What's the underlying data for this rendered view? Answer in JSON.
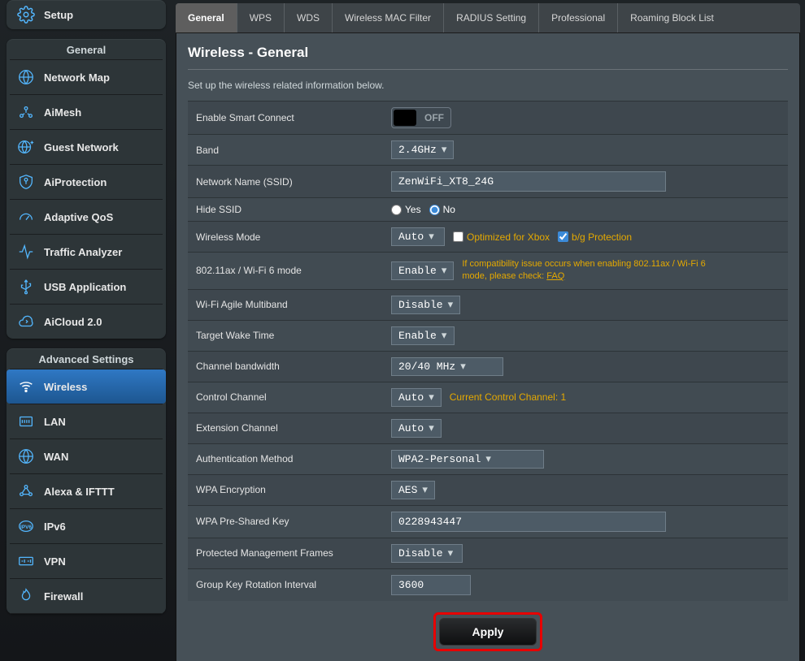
{
  "sidebar": {
    "top_item": "Setup",
    "general_header": "General",
    "general_items": [
      "Network Map",
      "AiMesh",
      "Guest Network",
      "AiProtection",
      "Adaptive QoS",
      "Traffic Analyzer",
      "USB Application",
      "AiCloud 2.0"
    ],
    "advanced_header": "Advanced Settings",
    "advanced_items": [
      "Wireless",
      "LAN",
      "WAN",
      "Alexa & IFTTT",
      "IPv6",
      "VPN",
      "Firewall"
    ],
    "selected": "Wireless"
  },
  "tabs": [
    "General",
    "WPS",
    "WDS",
    "Wireless MAC Filter",
    "RADIUS Setting",
    "Professional",
    "Roaming Block List"
  ],
  "active_tab": "General",
  "panel": {
    "title": "Wireless - General",
    "desc": "Set up the wireless related information below."
  },
  "fields": {
    "smart_connect": {
      "label": "Enable Smart Connect",
      "state": "OFF"
    },
    "band": {
      "label": "Band",
      "value": "2.4GHz"
    },
    "ssid": {
      "label": "Network Name (SSID)",
      "value": "ZenWiFi_XT8_24G"
    },
    "hide_ssid": {
      "label": "Hide SSID",
      "yes": "Yes",
      "no": "No"
    },
    "wmode": {
      "label": "Wireless Mode",
      "value": "Auto",
      "opt_xbox": "Optimized for Xbox",
      "bg": "b/g Protection"
    },
    "ax": {
      "label": "802.11ax / Wi-Fi 6 mode",
      "value": "Enable",
      "note_pre": "If compatibility issue occurs when enabling 802.11ax / Wi-Fi 6 mode, please check: ",
      "faq": "FAQ"
    },
    "agile": {
      "label": "Wi-Fi Agile Multiband",
      "value": "Disable"
    },
    "twt": {
      "label": "Target Wake Time",
      "value": "Enable"
    },
    "chbw": {
      "label": "Channel bandwidth",
      "value": "20/40 MHz"
    },
    "ctrlch": {
      "label": "Control Channel",
      "value": "Auto",
      "note": "Current Control Channel: 1"
    },
    "extch": {
      "label": "Extension Channel",
      "value": "Auto"
    },
    "auth": {
      "label": "Authentication Method",
      "value": "WPA2-Personal"
    },
    "wpaenc": {
      "label": "WPA Encryption",
      "value": "AES"
    },
    "wpakey": {
      "label": "WPA Pre-Shared Key",
      "value": "0228943447"
    },
    "pmf": {
      "label": "Protected Management Frames",
      "value": "Disable"
    },
    "gkri": {
      "label": "Group Key Rotation Interval",
      "value": "3600"
    }
  },
  "apply": "Apply"
}
